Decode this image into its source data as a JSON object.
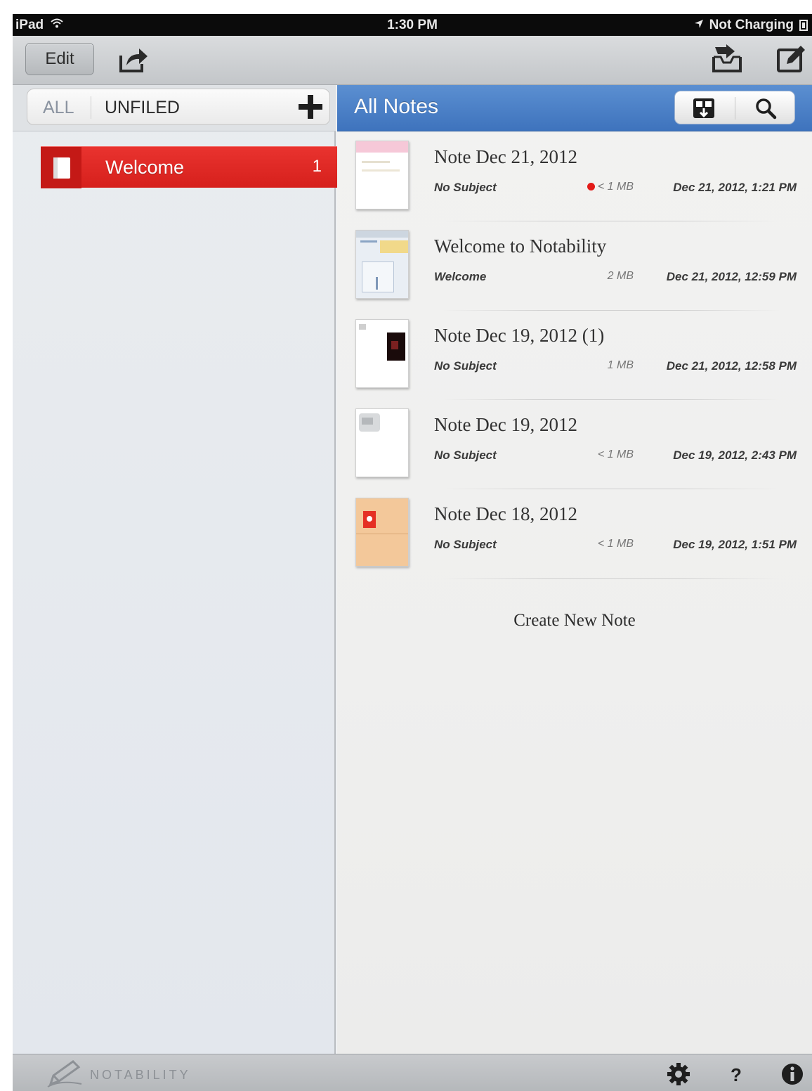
{
  "status_bar": {
    "device": "iPad",
    "time": "1:30 PM",
    "battery_text": "Not Charging"
  },
  "toolbar": {
    "edit_label": "Edit",
    "icons": [
      "share-icon",
      "inbox-import-icon",
      "compose-icon"
    ]
  },
  "sidebar": {
    "filter_all": "ALL",
    "filter_unfiled": "UNFILED",
    "subjects": [
      {
        "label": "Welcome",
        "count": "1",
        "color": "#e02a26"
      }
    ]
  },
  "notes_header": {
    "title": "All Notes",
    "icons": [
      "sort-icon",
      "search-icon"
    ],
    "color": "#4a80c7"
  },
  "notes": [
    {
      "title": "Note Dec 21, 2012",
      "subject": "No Subject",
      "size": "< 1 MB",
      "date": "Dec 21, 2012, 1:21 PM",
      "recording": true,
      "thumb": "pink-top"
    },
    {
      "title": "Welcome to Notability",
      "subject": "Welcome",
      "size": "2 MB",
      "date": "Dec 21, 2012, 12:59 PM",
      "recording": false,
      "thumb": "welcome"
    },
    {
      "title": "Note Dec 19, 2012 (1)",
      "subject": "No Subject",
      "size": "1 MB",
      "date": "Dec 21, 2012, 12:58 PM",
      "recording": false,
      "thumb": "dark-image"
    },
    {
      "title": "Note Dec 19, 2012",
      "subject": "No Subject",
      "size": "< 1 MB",
      "date": "Dec 19, 2012, 2:43 PM",
      "recording": false,
      "thumb": "sketch"
    },
    {
      "title": "Note Dec 18, 2012",
      "subject": "No Subject",
      "size": "< 1 MB",
      "date": "Dec 19, 2012, 1:51 PM",
      "recording": false,
      "thumb": "peach"
    }
  ],
  "create_note_label": "Create New Note",
  "bottom_bar": {
    "brand": "NOTABILITY",
    "icons": [
      "settings-gear-icon",
      "help-icon",
      "info-icon"
    ]
  }
}
